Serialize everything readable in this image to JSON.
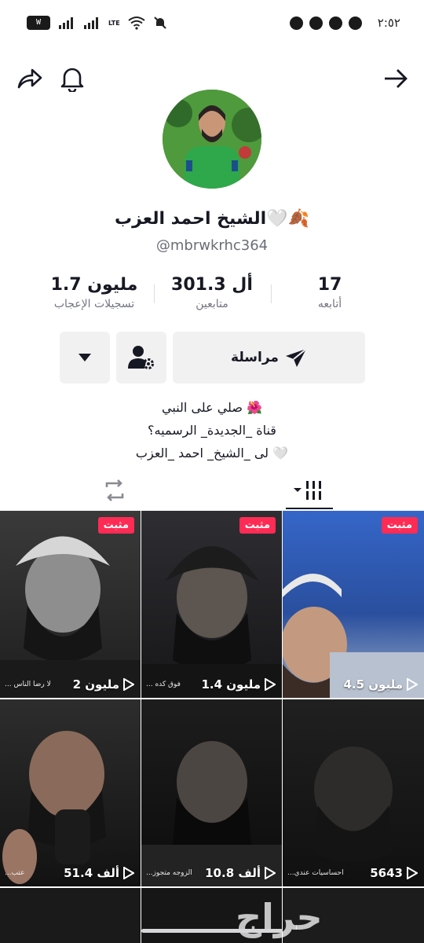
{
  "status_bar": {
    "time": "٢:٥٢",
    "left_badge": "W",
    "network_label": "LTE",
    "notifications_count_icons": 4
  },
  "header": {
    "back_icon": "arrow-right-icon",
    "bell_icon": "bell-icon",
    "share_icon": "share-icon"
  },
  "profile": {
    "name": "الشيخ احمد العزب🤍🍂",
    "handle": "@mbrwkrhc364",
    "stats": {
      "following": {
        "value": "17",
        "label": "أتابعه"
      },
      "followers": {
        "value": "301.3 أل",
        "label": "متابعين"
      },
      "likes": {
        "value": "1.7 مليون",
        "label": "تسجيلات الإعجاب"
      }
    },
    "actions": {
      "message_label": "مراسلة"
    },
    "bio": [
      "صلي على النبي 🌺",
      "قناة _الجديدة_ الرسميه؟",
      "لى _الشيخ_ احمد _العزب 🤍"
    ]
  },
  "tabs": {
    "videos_icon": "grid-icon",
    "reposts_icon": "repost-icon"
  },
  "videos": [
    {
      "pinned": "مثبت",
      "views": "4.5 مليون",
      "caption": ""
    },
    {
      "pinned": "مثبت",
      "views": "1.4 مليون",
      "caption": "... فوق كده"
    },
    {
      "pinned": "مثبت",
      "views": "2 مليون",
      "caption": "... لا رضا الناس"
    },
    {
      "pinned": "",
      "views": "5643",
      "caption": "...احساسيات عندي"
    },
    {
      "pinned": "",
      "views": "10.8 ألف",
      "caption": "...الزوجه متجوز"
    },
    {
      "pinned": "",
      "views": "51.4 ألف",
      "caption": "...عتب"
    }
  ],
  "watermark": "حراج",
  "colors": {
    "accent": "#fe2c55",
    "text": "#161823",
    "muted": "#737580",
    "button_bg": "#f1f1f2"
  }
}
